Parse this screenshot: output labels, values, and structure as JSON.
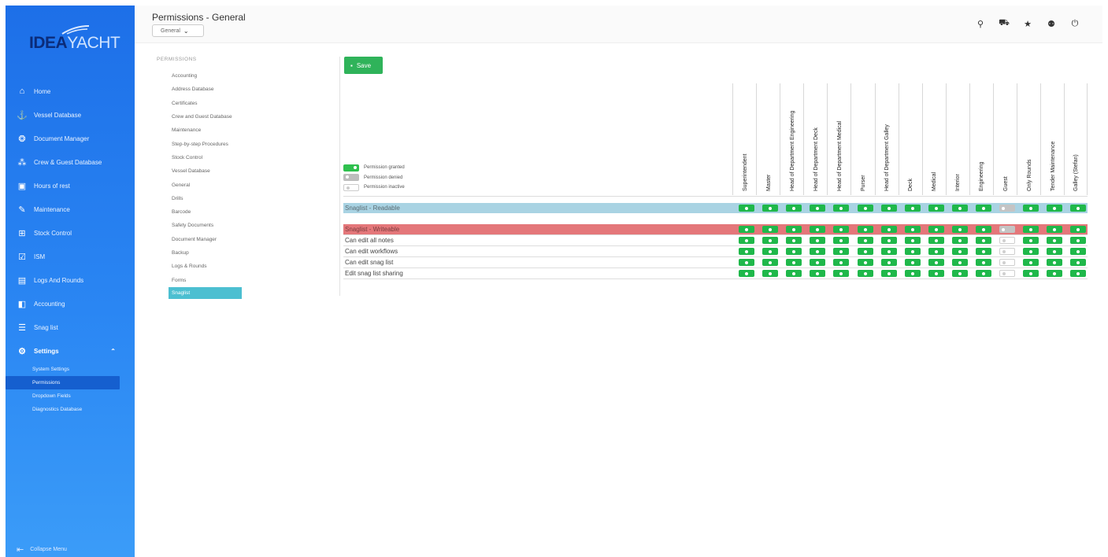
{
  "colors": {
    "sidebar": "#2a86f3",
    "granted": "#1fb84a",
    "denied": "#c4c4c4",
    "readable_row": "#a9d3e3",
    "writeable_row": "#e4777a",
    "save": "#2fb35a",
    "active_menu": "#4cbfd1"
  },
  "logo": {
    "idea": "IDEA",
    "yacht": "YACHT"
  },
  "sidebar": {
    "items": [
      {
        "label": "Home",
        "icon": "home-icon"
      },
      {
        "label": "Vessel Database",
        "icon": "anchor-icon"
      },
      {
        "label": "Document Manager",
        "icon": "document-icon"
      },
      {
        "label": "Crew & Guest Database",
        "icon": "crew-icon"
      },
      {
        "label": "Hours of rest",
        "icon": "calendar-icon"
      },
      {
        "label": "Maintenance",
        "icon": "wrench-icon"
      },
      {
        "label": "Stock Control",
        "icon": "stock-icon"
      },
      {
        "label": "ISM",
        "icon": "checklist-icon"
      },
      {
        "label": "Logs And Rounds",
        "icon": "logbook-icon"
      },
      {
        "label": "Accounting",
        "icon": "accounting-icon"
      },
      {
        "label": "Snag list",
        "icon": "list-icon"
      },
      {
        "label": "Settings",
        "icon": "gear-icon"
      }
    ],
    "settings_sub": [
      "System Settings",
      "Permissions",
      "Dropdown Fields",
      "Diagnostics Database"
    ],
    "collapse_label": "Collapse Menu"
  },
  "header": {
    "title": "Permissions - General",
    "dropdown_value": "General"
  },
  "permissions_menu": {
    "heading": "PERMISSIONS",
    "items": [
      "Accounting",
      "Address Database",
      "Certificates",
      "Crew and Guest Database",
      "Maintenance",
      "Step-by-step Procedures",
      "Stock Control",
      "Vessel Database",
      "General",
      "Drills",
      "Barcode",
      "Safety Documents",
      "Document Manager",
      "Backup",
      "Logs & Rounds",
      "Forms",
      "Snaglist"
    ]
  },
  "save_label": "Save",
  "legend": [
    "Permission granted",
    "Permission denied",
    "Permission inactive"
  ],
  "columns": [
    "Superintendent",
    "Master",
    "Head of Department Engineering",
    "Head of Department Deck",
    "Head of Department Medical",
    "Purser",
    "Head of Department Galley",
    "Deck",
    "Medical",
    "Interior",
    "Engineering",
    "Guest",
    "Only Rounds",
    "Tender Maintenance",
    "Galley (Stefan)"
  ],
  "rows": [
    {
      "label": "Snaglist - Readable",
      "kind": "readable",
      "states": [
        "granted",
        "granted",
        "granted",
        "granted",
        "granted",
        "granted",
        "granted",
        "granted",
        "granted",
        "granted",
        "granted",
        "denied",
        "granted",
        "granted",
        "granted"
      ]
    },
    {
      "label": "Snaglist - Writeable",
      "kind": "writeable",
      "states": [
        "granted",
        "granted",
        "granted",
        "granted",
        "granted",
        "granted",
        "granted",
        "granted",
        "granted",
        "granted",
        "granted",
        "denied",
        "granted",
        "granted",
        "granted"
      ]
    },
    {
      "label": "Can edit all notes",
      "kind": "normal",
      "states": [
        "granted",
        "granted",
        "granted",
        "granted",
        "granted",
        "granted",
        "granted",
        "granted",
        "granted",
        "granted",
        "granted",
        "inactive",
        "granted",
        "granted",
        "granted"
      ]
    },
    {
      "label": "Can edit workflows",
      "kind": "normal",
      "states": [
        "granted",
        "granted",
        "granted",
        "granted",
        "granted",
        "granted",
        "granted",
        "granted",
        "granted",
        "granted",
        "granted",
        "inactive",
        "granted",
        "granted",
        "granted"
      ]
    },
    {
      "label": "Can edit snag list",
      "kind": "normal",
      "states": [
        "granted",
        "granted",
        "granted",
        "granted",
        "granted",
        "granted",
        "granted",
        "granted",
        "granted",
        "granted",
        "granted",
        "inactive",
        "granted",
        "granted",
        "granted"
      ]
    },
    {
      "label": "Edit snag list sharing",
      "kind": "normal",
      "states": [
        "granted",
        "granted",
        "granted",
        "granted",
        "granted",
        "granted",
        "granted",
        "granted",
        "granted",
        "granted",
        "granted",
        "inactive",
        "granted",
        "granted",
        "granted"
      ]
    }
  ]
}
